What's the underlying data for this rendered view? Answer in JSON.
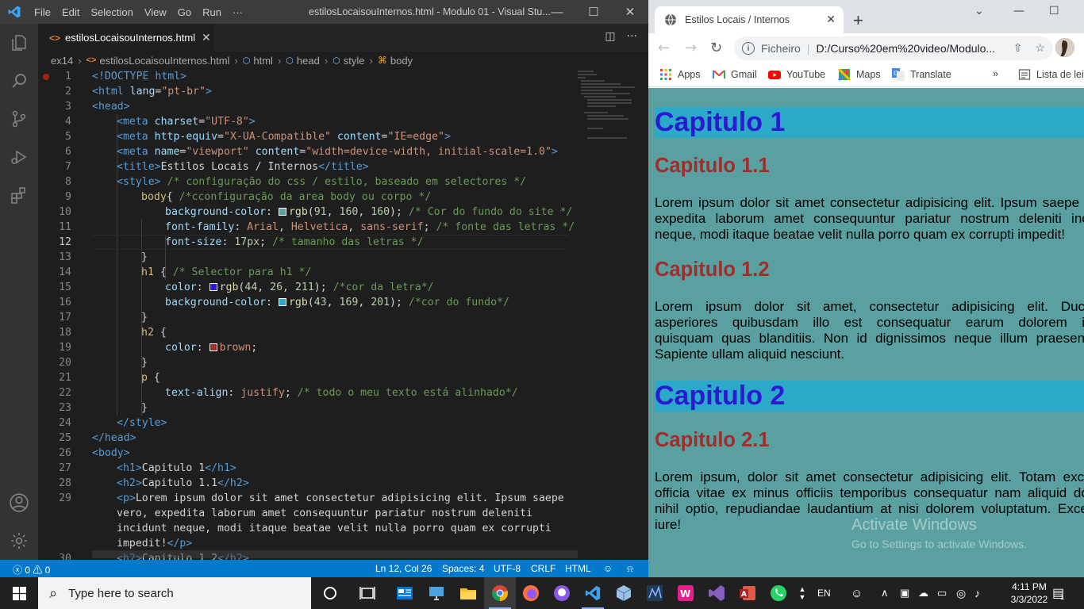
{
  "vscode": {
    "menu": [
      "File",
      "Edit",
      "Selection",
      "View",
      "Go",
      "Run",
      "···"
    ],
    "window_title": "estilosLocaisouInternos.html - Modulo 01 - Visual Stu...",
    "tab": {
      "label": "estilosLocaisouInternos.html"
    },
    "breadcrumb": [
      "ex14",
      "estilosLocaisouInternos.html",
      "html",
      "head",
      "style",
      "body"
    ],
    "status": {
      "problems": "ⓧ 0 ⚠ 0",
      "cursor": "Ln 12, Col 26",
      "spaces": "Spaces: 4",
      "encoding": "UTF-8",
      "eol": "CRLF",
      "language": "HTML"
    },
    "code_lines": [
      {
        "n": "1"
      },
      {
        "n": "2"
      },
      {
        "n": "3"
      },
      {
        "n": "4"
      },
      {
        "n": "5"
      },
      {
        "n": "6"
      },
      {
        "n": "7"
      },
      {
        "n": "8"
      },
      {
        "n": "9"
      },
      {
        "n": "10"
      },
      {
        "n": "11"
      },
      {
        "n": "12"
      },
      {
        "n": "13"
      },
      {
        "n": "14"
      },
      {
        "n": "15"
      },
      {
        "n": "16"
      },
      {
        "n": "17"
      },
      {
        "n": "18"
      },
      {
        "n": "19"
      },
      {
        "n": "20"
      },
      {
        "n": "21"
      },
      {
        "n": "22"
      },
      {
        "n": "23"
      },
      {
        "n": "24"
      },
      {
        "n": "25"
      },
      {
        "n": "26"
      },
      {
        "n": "27"
      },
      {
        "n": "28"
      },
      {
        "n": "29"
      },
      {
        "n": "30"
      }
    ],
    "code": {
      "l1": "<!DOCTYPE html>",
      "l2a": "<html",
      "l2b": " lang",
      "l2c": "=",
      "l2d": "\"pt-br\"",
      "l2e": ">",
      "l3": "<head>",
      "l4a": "<meta",
      "l4b": " charset",
      "l4c": "=",
      "l4d": "\"UTF-8\"",
      "l4e": ">",
      "l5a": "<meta",
      "l5b": " http-equiv",
      "l5c": "=",
      "l5d": "\"X-UA-Compatible\"",
      "l5f": " content",
      "l5g": "=",
      "l5h": "\"IE=edge\"",
      "l5e": ">",
      "l6a": "<meta",
      "l6b": " name",
      "l6c": "=",
      "l6d": "\"viewport\"",
      "l6f": " content",
      "l6g": "=",
      "l6h": "\"width=device-width, initial-scale=1.0\"",
      "l6e": ">",
      "l7a": "<title>",
      "l7b": "Estilos Locais / Internos",
      "l7c": "</title>",
      "l8a": "<style>",
      "l8b": " /* configuração do css / estilo, baseado em selectores */",
      "l9a": "body",
      "l9b": "{ ",
      "l9c": "/*cconfiguração da area body ou corpo */",
      "l10a": "background-color",
      "l10b": ": ",
      "l10c": "rgb",
      "l10d": "(",
      "l10e": "91",
      "l10f": ", ",
      "l10g": "160",
      "l10h": ", ",
      "l10i": "160",
      "l10j": "); ",
      "l10k": "/* Cor do fundo do site */",
      "l11a": "font-family",
      "l11b": ": ",
      "l11c": "Arial",
      "l11d": ", ",
      "l11e": "Helvetica",
      "l11f": ", ",
      "l11g": "sans-serif",
      "l11h": "; ",
      "l11i": "/* fonte das letras */",
      "l12a": "font-size",
      "l12b": ": ",
      "l12c": "17px",
      "l12d": "; ",
      "l12e": "/* tamanho das letras */",
      "l13": "}",
      "l14a": "h1",
      "l14b": " { ",
      "l14c": "/* Selector para h1 */",
      "l15a": "color",
      "l15b": ": ",
      "l15c": "rgb",
      "l15d": "(",
      "l15e": "44",
      "l15f": ", ",
      "l15g": "26",
      "l15h": ", ",
      "l15i": "211",
      "l15j": "); ",
      "l15k": "/*cor da letra*/",
      "l16a": "background-color",
      "l16b": ": ",
      "l16c": "rgb",
      "l16d": "(",
      "l16e": "43",
      "l16f": ", ",
      "l16g": "169",
      "l16h": ", ",
      "l16i": "201",
      "l16j": "); ",
      "l16k": "/*cor do fundo*/",
      "l17": "}",
      "l18a": "h2",
      "l18b": " {",
      "l19a": "color",
      "l19b": ": ",
      "l19c": "brown",
      "l19d": ";",
      "l20": "}",
      "l21a": "p",
      "l21b": " {",
      "l22a": "text-align",
      "l22b": ": ",
      "l22c": "justify",
      "l22d": "; ",
      "l22e": "/* todo o meu texto está alinhado*/",
      "l23": "}",
      "l24": "</style>",
      "l25": "</head>",
      "l26": "<body>",
      "l27a": "<h1>",
      "l27b": "Capitulo 1",
      "l27c": "</h1>",
      "l28a": "<h2>",
      "l28b": "Capitulo 1.1",
      "l28c": "</h2>",
      "l29a": "<p>",
      "l29b": "Lorem ipsum dolor sit amet consectetur adipisicing elit. Ipsum saepe",
      "l29c": "vero, expedita laborum amet consequuntur pariatur nostrum deleniti",
      "l29d": "incidunt neque, modi itaque beatae velit nulla porro quam ex corrupti",
      "l29e": "impedit!",
      "l29f": "</p>",
      "l30a": "<h2>",
      "l30b": "Capitulo 1.2",
      "l30c": "</h2>"
    },
    "colors": {
      "swatch_bg": "#5ba0a0",
      "swatch_h1_color": "#2c1ad3",
      "swatch_h1_bg": "#2ba9c9",
      "swatch_brown": "#a52a2a"
    }
  },
  "chrome": {
    "tab_title": "Estilos Locais / Internos",
    "omnibox_scheme": "Ficheiro",
    "omnibox_url": "D:/Curso%20em%20video/Modulo...",
    "bookmarks": [
      "Apps",
      "Gmail",
      "YouTube",
      "Maps",
      "Translate"
    ],
    "reading_list": "Lista de leit",
    "page": {
      "h1_a": "Capitulo 1",
      "h2_a": "Capitulo 1.1",
      "p1": [
        "Lorem ipsum dolor sit amet consectetur adipisicing elit. Ipsum saepe ve",
        "expedita laborum amet consequuntur pariatur nostrum deleniti incid",
        "neque, modi itaque beatae velit nulla porro quam ex corrupti impedit!"
      ],
      "h2_b": "Capitulo 1.2",
      "p2": [
        "Lorem ipsum dolor sit amet, consectetur adipisicing elit. Ducim",
        "asperiores quibusdam illo est consequatur earum dolorem ips",
        "quisquam quas blanditiis. Non id dignissimos neque illum praesentiu",
        "Sapiente ullam aliquid nesciunt."
      ],
      "h1_b": "Capitulo 2",
      "h2_c": "Capitulo 2.1",
      "p3": [
        "Lorem ipsum, dolor sit amet consectetur adipisicing elit. Totam excep",
        "officia vitae ex minus officiis temporibus consequatur nam aliquid dolo",
        "nihil optio, repudiandae laudantium at nisi dolorem voluptatum. Except",
        "iure!"
      ]
    },
    "watermark": {
      "title": "Activate Windows",
      "subtitle": "Go to Settings to activate Windows."
    }
  },
  "taskbar": {
    "search_placeholder": "Type here to search",
    "lang": "EN",
    "time": "4:11 PM",
    "date": "3/3/2022",
    "notifications": "1"
  }
}
